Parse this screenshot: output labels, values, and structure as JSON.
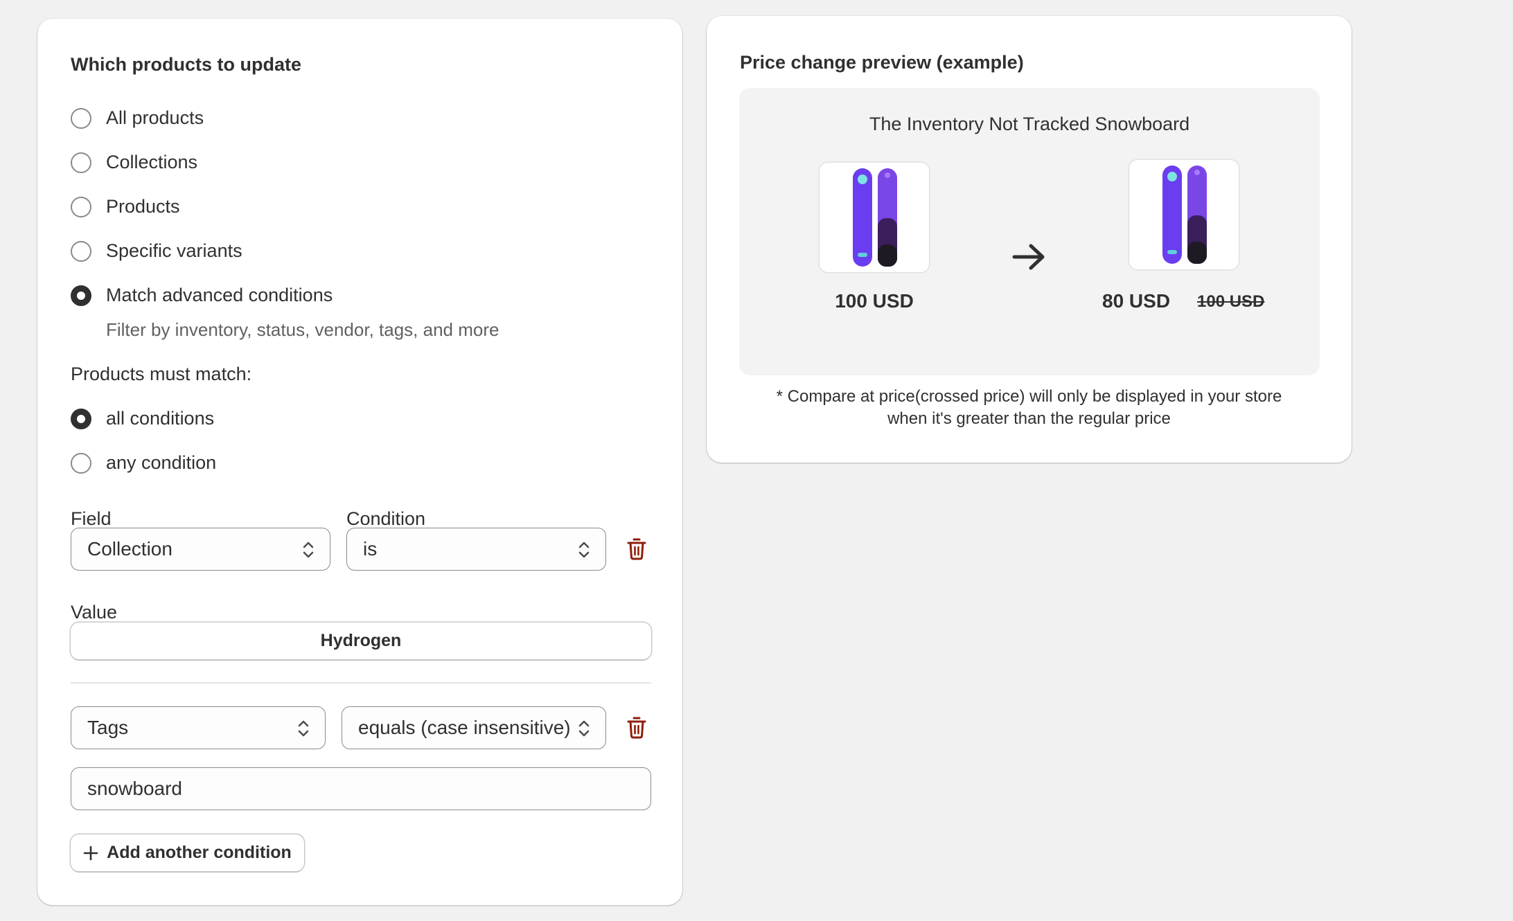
{
  "products_section": {
    "title": "Which products to update",
    "options": [
      {
        "label": "All products",
        "checked": false
      },
      {
        "label": "Collections",
        "checked": false
      },
      {
        "label": "Products",
        "checked": false
      },
      {
        "label": "Specific variants",
        "checked": false
      },
      {
        "label": "Match advanced conditions",
        "checked": true,
        "help": "Filter by inventory, status, vendor, tags, and more"
      }
    ],
    "match_label": "Products must match:",
    "match_options": [
      {
        "label": "all conditions",
        "checked": true
      },
      {
        "label": "any condition",
        "checked": false
      }
    ],
    "field_label": "Field",
    "condition_label": "Condition",
    "value_label": "Value",
    "conditions": [
      {
        "field": "Collection",
        "condition": "is",
        "value": "Hydrogen"
      },
      {
        "field": "Tags",
        "condition": "equals (case insensitive)",
        "value": "snowboard"
      }
    ],
    "add_button": "Add another condition"
  },
  "preview": {
    "title": "Price change preview (example)",
    "product_name": "The Inventory Not Tracked Snowboard",
    "before_price": "100 USD",
    "after_price": "80 USD",
    "compare_at_price": "100 USD",
    "note_line1": "* Compare at price(crossed price) will only be displayed in your store",
    "note_line2": "when it's greater than the regular price"
  },
  "colors": {
    "accent_dark": "#303030",
    "danger": "#8e1f0b",
    "snowboard_purple": "#6b3df0",
    "background": "#f1f1f1"
  },
  "icons": [
    "chevron-up-down-icon",
    "trash-icon",
    "plus-icon",
    "arrow-right-icon"
  ]
}
